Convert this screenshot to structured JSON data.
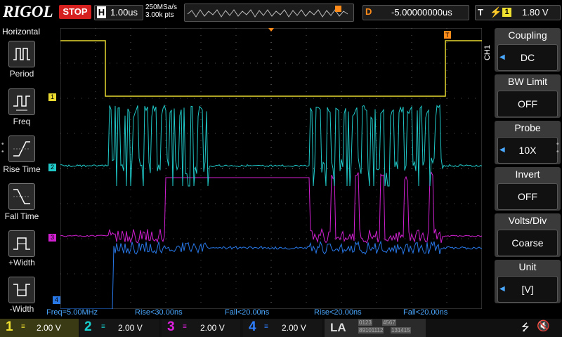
{
  "topbar": {
    "brand": "RIGOL",
    "run_state": "STOP",
    "timebase_label": "H",
    "timebase_value": "1.00us",
    "sample_rate": "250MSa/s",
    "memory_points": "3.00k pts",
    "delay_label": "D",
    "delay_value": "-5.00000000us",
    "trigger_label": "T",
    "trigger_source": "1",
    "trigger_level": "1.80 V"
  },
  "left_menu": {
    "title": "Horizontal",
    "items": [
      {
        "label": "Period",
        "icon": "period-icon"
      },
      {
        "label": "Freq",
        "icon": "frequency-icon"
      },
      {
        "label": "Rise Time",
        "icon": "rise-time-icon"
      },
      {
        "label": "Fall Time",
        "icon": "fall-time-icon"
      },
      {
        "label": "+Width",
        "icon": "positive-width-icon"
      },
      {
        "label": "-Width",
        "icon": "negative-width-icon"
      }
    ]
  },
  "right_menu": {
    "channel": "CH1",
    "items": [
      {
        "title": "Coupling",
        "value": "DC"
      },
      {
        "title": "BW Limit",
        "value": "OFF"
      },
      {
        "title": "Probe",
        "value": "10X"
      },
      {
        "title": "Invert",
        "value": "OFF"
      },
      {
        "title": "Volts/Div",
        "value": "Coarse"
      },
      {
        "title": "Unit",
        "value": "[V]"
      }
    ]
  },
  "channel_markers": [
    "1",
    "2",
    "3",
    "4"
  ],
  "measurements": [
    "Freq=5.00MHz",
    "Rise<30.00ns",
    "Fall<20.00ns",
    "Rise<20.00ns",
    "Fall<20.00ns"
  ],
  "bottom": {
    "channels": [
      {
        "num": "1",
        "scale": "2.00 V",
        "color": "#f0e030"
      },
      {
        "num": "2",
        "scale": "2.00 V",
        "color": "#18d0d0"
      },
      {
        "num": "3",
        "scale": "2.00 V",
        "color": "#e020e0"
      },
      {
        "num": "4",
        "scale": "2.00 V",
        "color": "#2f7fff"
      }
    ],
    "la_label": "LA",
    "digital_groups": [
      "0123",
      "4567",
      "89101112",
      "131415"
    ]
  },
  "colors": {
    "ch1": "#e8d830",
    "ch2": "#20c8c8",
    "ch3": "#d020d0",
    "ch4": "#2878e8",
    "trigger": "#ff8c1a",
    "stop": "#d61f1f",
    "grid": "#3a3a3a"
  }
}
